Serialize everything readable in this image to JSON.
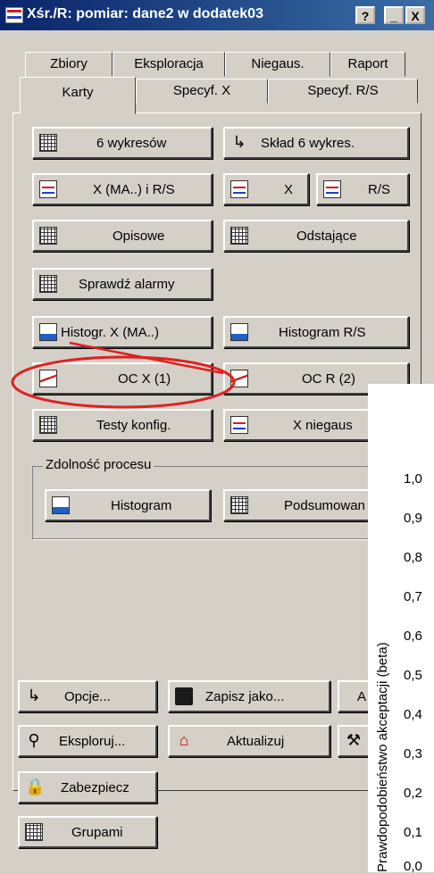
{
  "window": {
    "title": "Xśr./R: pomiar: dane2 w dodatek03",
    "help": "?",
    "minimize": "_",
    "close": "X"
  },
  "tabs_row1": [
    "Zbiory",
    "Eksploracja",
    "Niegaus.",
    "Raport"
  ],
  "tabs_row2": [
    "Karty",
    "Specyf. X",
    "Specyf. R/S"
  ],
  "buttons": {
    "six_charts": "6 wykresów",
    "six_charts_comp": "Skład 6 wykres.",
    "x_ma_rs": "X (MA..) i R/S",
    "x": "X",
    "rs": "R/S",
    "descriptive": "Opisowe",
    "outliers": "Odstające",
    "check_alarms": "Sprawdź alarmy",
    "histogram_x": "Histogr. X (MA..)",
    "histogram_rs": "Histogram R/S",
    "oc_x": "OC X (1)",
    "oc_r": "OC R (2)",
    "config_tests": "Testy konfig.",
    "x_nongauss": "X niegaus"
  },
  "capability": {
    "label": "Zdolność procesu",
    "histogram": "Histogram",
    "summary": "Podsumowan"
  },
  "bottom": {
    "options": "Opcje...",
    "save_as": "Zapisz jako...",
    "explore": "Eksploruj...",
    "update": "Aktualizuj",
    "protect": "Zabezpiecz",
    "groups": "Grupami",
    "cut_a": "A"
  },
  "chart": {
    "ylabel": "Prawdopodobieństwo akceptacji (beta)",
    "ticks": [
      "1,0",
      "0,9",
      "0,8",
      "0,7",
      "0,6",
      "0,5",
      "0,4",
      "0,3",
      "0,2",
      "0,1",
      "0,0"
    ]
  },
  "colors": {
    "title_start": "#0a246a",
    "title_end": "#3a6ea5",
    "face": "#d4d0c8",
    "annotation": "#e02020"
  }
}
